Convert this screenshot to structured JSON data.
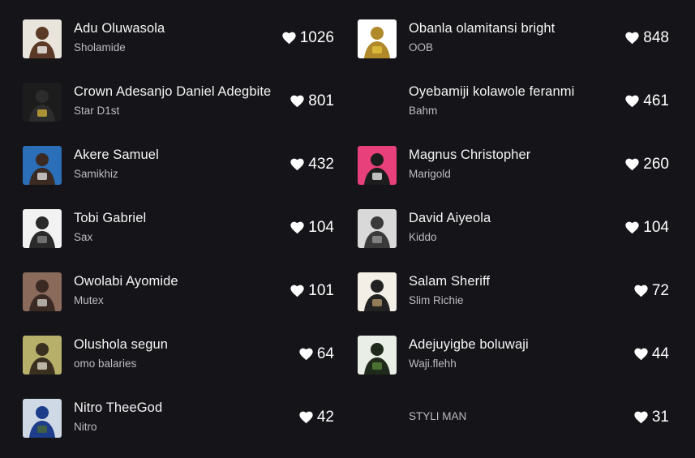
{
  "columns": [
    {
      "rows": [
        {
          "name": "Adu Oluwasola",
          "handle": "Sholamide",
          "likes": "1026",
          "avatar": {
            "bg": "#e9e4dc",
            "fg": "#5a3a26",
            "accent": "#ffffff"
          }
        },
        {
          "name": "Crown Adesanjo Daniel Adegbite",
          "handle": "Star D1st",
          "likes": "801",
          "avatar": {
            "bg": "#1c1c1c",
            "fg": "#2c2c2c",
            "accent": "#d6b33a"
          }
        },
        {
          "name": "Akere Samuel",
          "handle": "Samikhiz",
          "likes": "432",
          "avatar": {
            "bg": "#2b6fb8",
            "fg": "#3a2a22",
            "accent": "#e8e8e8"
          }
        },
        {
          "name": "Tobi Gabriel",
          "handle": "Sax",
          "likes": "104",
          "avatar": {
            "bg": "#f2f2f2",
            "fg": "#2a2a2a",
            "accent": "#888888"
          }
        },
        {
          "name": "Owolabi Ayomide",
          "handle": "Mutex",
          "likes": "101",
          "avatar": {
            "bg": "#8a6a5a",
            "fg": "#3b2a24",
            "accent": "#d8d3cc"
          }
        },
        {
          "name": "Olushola segun",
          "handle": "omo balaries",
          "likes": "64",
          "avatar": {
            "bg": "#b7b06a",
            "fg": "#3a3020",
            "accent": "#e6e1d0"
          }
        },
        {
          "name": "Nitro TheeGod",
          "handle": "Nitro",
          "likes": "42",
          "avatar": {
            "bg": "#cfd9e6",
            "fg": "#1d3d8a",
            "accent": "#4c6b2e"
          }
        }
      ]
    },
    {
      "rows": [
        {
          "name": "Obanla olamitansi bright",
          "handle": "OOB",
          "likes": "848",
          "avatar": {
            "bg": "#ffffff",
            "fg": "#b08a2a",
            "accent": "#e6c43c"
          }
        },
        {
          "name": "Oyebamiji kolawole feranmi",
          "handle": "Bahm",
          "likes": "461",
          "avatar": null
        },
        {
          "name": "Magnus Christopher",
          "handle": "Marigold",
          "likes": "260",
          "avatar": {
            "bg": "#e8407a",
            "fg": "#1d1d1d",
            "accent": "#f4f4f4"
          }
        },
        {
          "name": "David Aiyeola",
          "handle": "Kiddo",
          "likes": "104",
          "avatar": {
            "bg": "#d9d9d9",
            "fg": "#3a3a3a",
            "accent": "#9a9a9a"
          }
        },
        {
          "name": "Salam Sheriff",
          "handle": "Slim Richie",
          "likes": "72",
          "avatar": {
            "bg": "#f3efe6",
            "fg": "#222222",
            "accent": "#b89a6a"
          }
        },
        {
          "name": "Adejuyigbe boluwaji",
          "handle": "Waji.flehh",
          "likes": "44",
          "avatar": {
            "bg": "#e9efe6",
            "fg": "#1f2a1c",
            "accent": "#5b8a3a"
          }
        },
        {
          "name": "",
          "handle": "STYLI MAN",
          "likes": "31",
          "avatar": null
        }
      ]
    }
  ],
  "icons": {
    "like": "heart-icon"
  },
  "colors": {
    "background": "#151418",
    "text": "#f5f5f5",
    "muted": "#bdbcc2"
  }
}
